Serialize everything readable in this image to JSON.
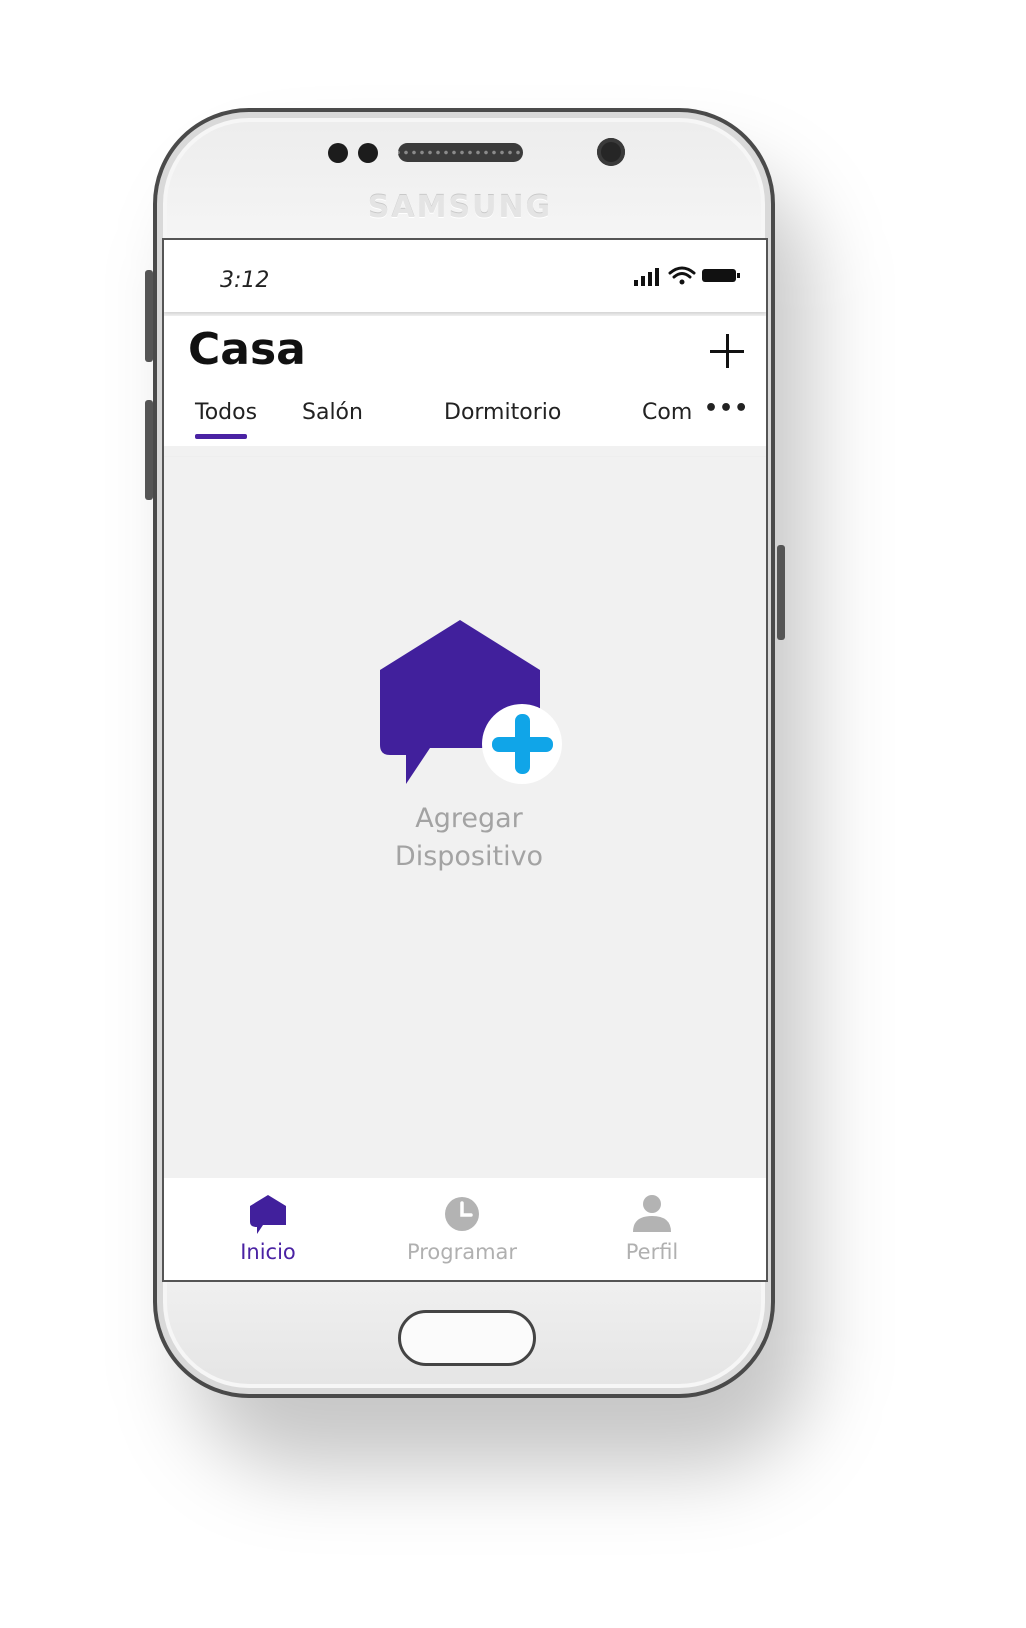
{
  "device": {
    "brand": "SAMSUNG"
  },
  "status_bar": {
    "time": "3:12",
    "icons": [
      "signal-icon",
      "wifi-icon",
      "battery-icon"
    ]
  },
  "header": {
    "title": "Casa",
    "add_icon": "plus-icon"
  },
  "tabs": {
    "items": [
      {
        "label": "Todos",
        "active": true
      },
      {
        "label": "Salón",
        "active": false
      },
      {
        "label": "Dormitorio",
        "active": false
      },
      {
        "label": "Com",
        "active": false
      }
    ],
    "more_label": "•••"
  },
  "empty_state": {
    "icon": "add-device-icon",
    "line1": "Agregar",
    "line2": "Dispositivo"
  },
  "bottom_nav": {
    "items": [
      {
        "label": "Inicio",
        "icon": "home-icon",
        "active": true
      },
      {
        "label": "Programar",
        "icon": "clock-icon",
        "active": false
      },
      {
        "label": "Perfil",
        "icon": "user-icon",
        "active": false
      }
    ]
  },
  "colors": {
    "accent": "#4a22a3",
    "add_badge": "#10a5e8",
    "inactive": "#b0b0b0",
    "screen_bg": "#f1f1f1"
  }
}
